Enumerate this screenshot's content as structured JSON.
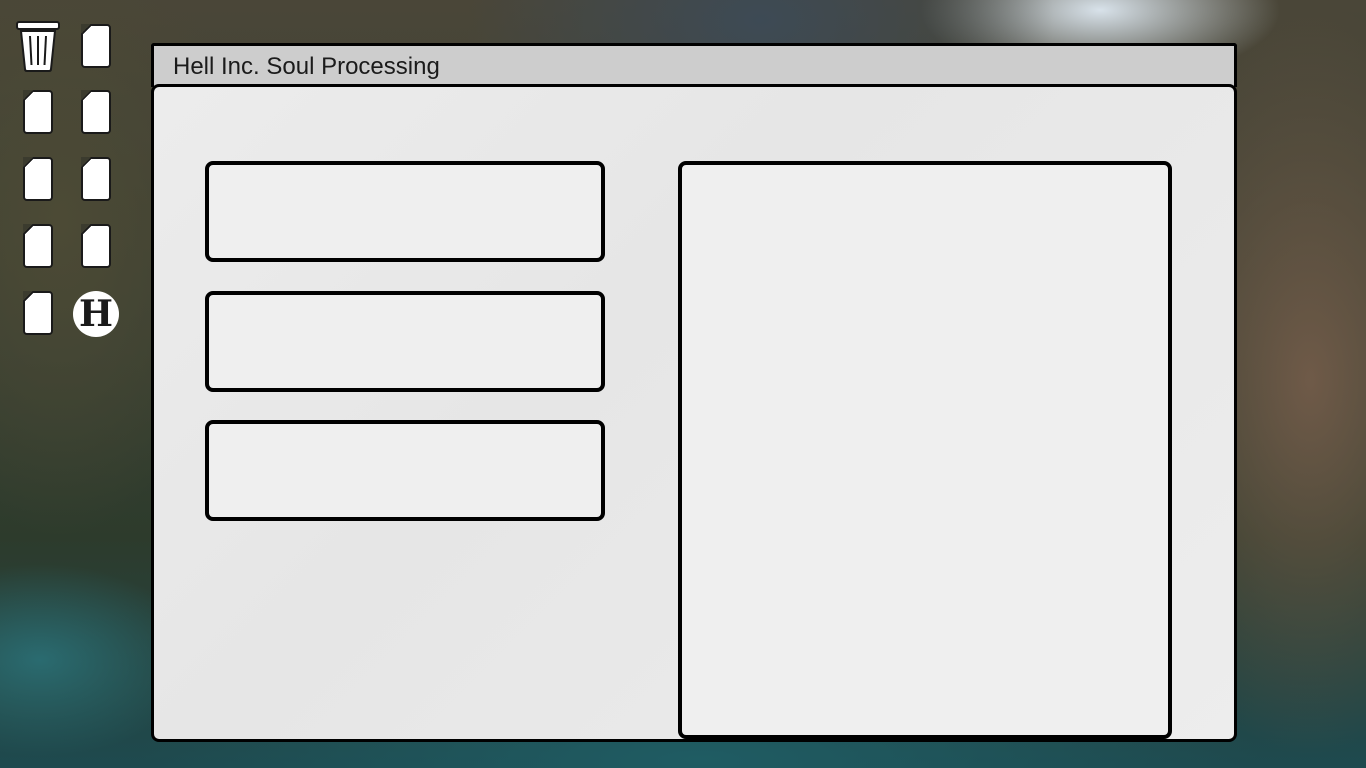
{
  "window": {
    "title": "Hell Inc. Soul Processing"
  },
  "desktop": {
    "icons": [
      {
        "name": "trash-icon"
      },
      {
        "name": "file-icon"
      },
      {
        "name": "file-icon"
      },
      {
        "name": "file-icon"
      },
      {
        "name": "file-icon"
      },
      {
        "name": "file-icon"
      },
      {
        "name": "file-icon"
      },
      {
        "name": "file-icon"
      },
      {
        "name": "file-icon"
      },
      {
        "name": "hell-inc-app-icon",
        "glyph": "H"
      }
    ]
  },
  "colors": {
    "titlebar": "#cdcdcd",
    "window_body": "#ececec",
    "border": "#000000",
    "panel": "#efefef"
  }
}
